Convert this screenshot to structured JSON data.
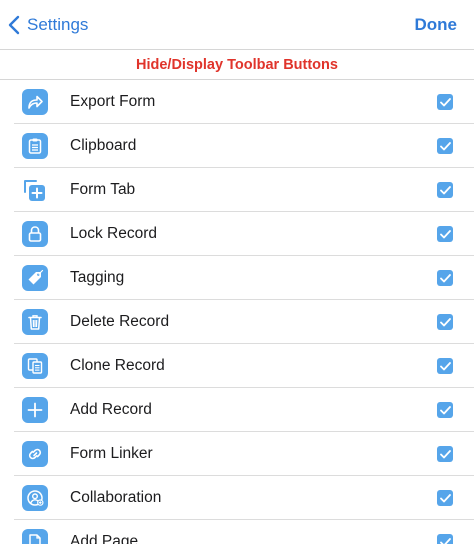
{
  "navbar": {
    "back_label": "Settings",
    "done_label": "Done"
  },
  "section": {
    "title": "Hide/Display Toolbar Buttons"
  },
  "rows": [
    {
      "label": "Export Form",
      "icon": "export-arrow-icon",
      "checked": true
    },
    {
      "label": "Clipboard",
      "icon": "clipboard-icon",
      "checked": true
    },
    {
      "label": "Form Tab",
      "icon": "form-tab-plus-icon",
      "checked": true
    },
    {
      "label": "Lock Record",
      "icon": "lock-icon",
      "checked": true
    },
    {
      "label": "Tagging",
      "icon": "tag-icon",
      "checked": true
    },
    {
      "label": "Delete Record",
      "icon": "trash-icon",
      "checked": true
    },
    {
      "label": "Clone Record",
      "icon": "clone-documents-icon",
      "checked": true
    },
    {
      "label": "Add Record",
      "icon": "plus-icon",
      "checked": true
    },
    {
      "label": "Form Linker",
      "icon": "link-icon",
      "checked": true
    },
    {
      "label": "Collaboration",
      "icon": "collaboration-user-icon",
      "checked": true
    },
    {
      "label": "Add Page",
      "icon": "add-page-icon",
      "checked": true
    }
  ],
  "colors": {
    "accent": "#2f7ad8",
    "icon_tile": "#56a5ea",
    "section_title": "#e0342b"
  }
}
